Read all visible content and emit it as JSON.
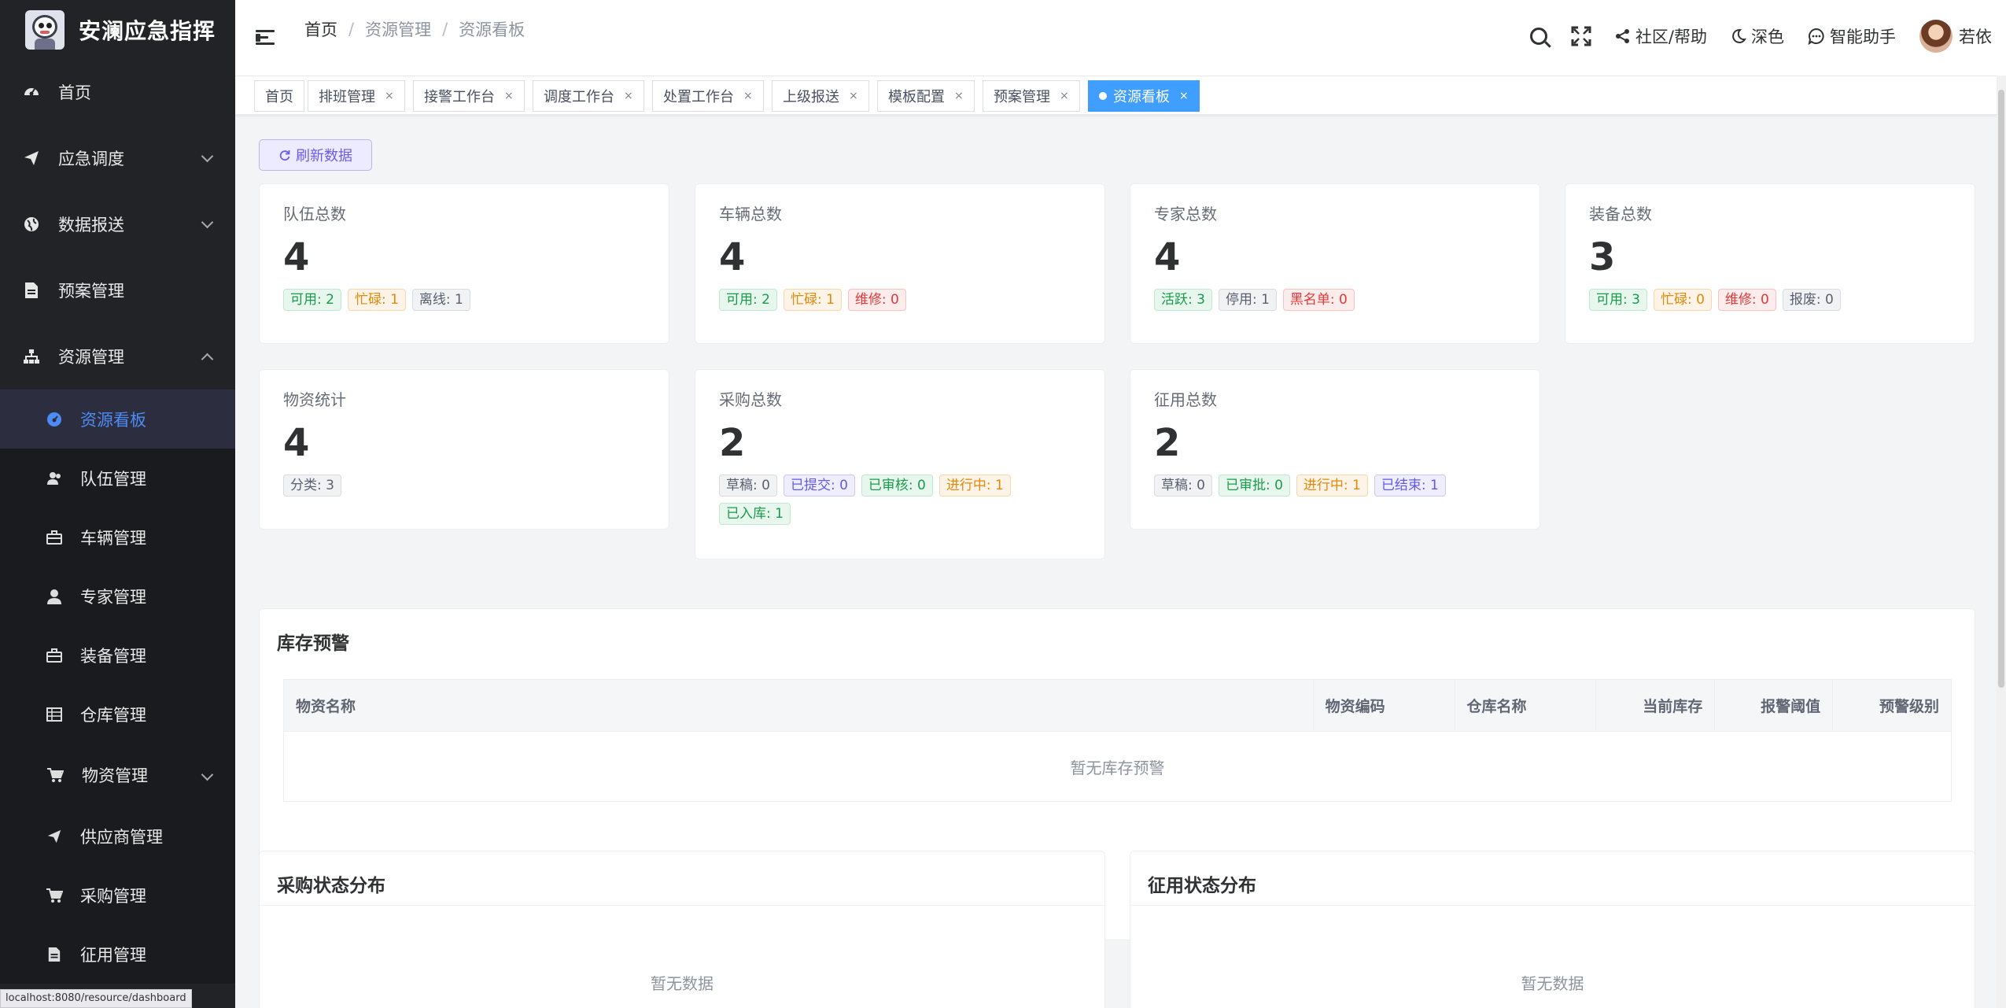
{
  "app": {
    "title": "安澜应急指挥",
    "status_url": "localhost:8080/resource/dashboard"
  },
  "sidebar": {
    "items": [
      {
        "label": "首页",
        "icon": "dashboard-icon"
      },
      {
        "label": "应急调度",
        "icon": "send-icon"
      },
      {
        "label": "数据报送",
        "icon": "globe-icon"
      },
      {
        "label": "预案管理",
        "icon": "document-icon"
      },
      {
        "label": "资源管理",
        "icon": "sitemap-icon"
      }
    ],
    "sub_items": [
      {
        "label": "资源看板",
        "icon": "gauge-icon"
      },
      {
        "label": "队伍管理",
        "icon": "team-icon"
      },
      {
        "label": "车辆管理",
        "icon": "briefcase-icon"
      },
      {
        "label": "专家管理",
        "icon": "user-icon"
      },
      {
        "label": "装备管理",
        "icon": "briefcase-icon"
      },
      {
        "label": "仓库管理",
        "icon": "grid-icon"
      },
      {
        "label": "物资管理",
        "icon": "cart-icon"
      },
      {
        "label": "供应商管理",
        "icon": "send-icon"
      },
      {
        "label": "采购管理",
        "icon": "cart-icon"
      },
      {
        "label": "征用管理",
        "icon": "document-icon"
      }
    ]
  },
  "header": {
    "breadcrumb": [
      "首页",
      "资源管理",
      "资源看板"
    ],
    "community": "社区/帮助",
    "theme": "深色",
    "assistant": "智能助手",
    "user": "若依"
  },
  "tabs": [
    {
      "label": "首页",
      "closable": false
    },
    {
      "label": "排班管理",
      "closable": true
    },
    {
      "label": "接警工作台",
      "closable": true
    },
    {
      "label": "调度工作台",
      "closable": true
    },
    {
      "label": "处置工作台",
      "closable": true
    },
    {
      "label": "上级报送",
      "closable": true
    },
    {
      "label": "模板配置",
      "closable": true
    },
    {
      "label": "预案管理",
      "closable": true
    },
    {
      "label": "资源看板",
      "closable": true,
      "active": true
    }
  ],
  "tab_close": "×",
  "refresh_label": "刷新数据",
  "cards": [
    {
      "title": "队伍总数",
      "value": "4",
      "chips": [
        {
          "text": "可用: 2",
          "color": "green"
        },
        {
          "text": "忙碌: 1",
          "color": "orange"
        },
        {
          "text": "离线: 1",
          "color": "gray"
        }
      ]
    },
    {
      "title": "车辆总数",
      "value": "4",
      "chips": [
        {
          "text": "可用: 2",
          "color": "green"
        },
        {
          "text": "忙碌: 1",
          "color": "orange"
        },
        {
          "text": "维修: 0",
          "color": "red"
        }
      ]
    },
    {
      "title": "专家总数",
      "value": "4",
      "chips": [
        {
          "text": "活跃: 3",
          "color": "green"
        },
        {
          "text": "停用: 1",
          "color": "gray"
        },
        {
          "text": "黑名单: 0",
          "color": "red"
        }
      ]
    },
    {
      "title": "装备总数",
      "value": "3",
      "chips": [
        {
          "text": "可用: 3",
          "color": "green"
        },
        {
          "text": "忙碌: 0",
          "color": "orange"
        },
        {
          "text": "维修: 0",
          "color": "red"
        },
        {
          "text": "报废: 0",
          "color": "gray"
        }
      ]
    },
    {
      "title": "物资统计",
      "value": "4",
      "chips": [
        {
          "text": "分类: 3",
          "color": "gray"
        }
      ]
    },
    {
      "title": "采购总数",
      "value": "2",
      "chips": [
        {
          "text": "草稿: 0",
          "color": "gray"
        },
        {
          "text": "已提交: 0",
          "color": "purple"
        },
        {
          "text": "已审核: 0",
          "color": "green"
        },
        {
          "text": "进行中: 1",
          "color": "orange"
        },
        {
          "text": "已入库: 1",
          "color": "green"
        }
      ]
    },
    {
      "title": "征用总数",
      "value": "2",
      "chips": [
        {
          "text": "草稿: 0",
          "color": "gray"
        },
        {
          "text": "已审批: 0",
          "color": "green"
        },
        {
          "text": "进行中: 1",
          "color": "orange"
        },
        {
          "text": "已结束: 1",
          "color": "purple"
        }
      ]
    }
  ],
  "inventory": {
    "title": "库存预警",
    "columns": [
      "物资名称",
      "物资编码",
      "仓库名称",
      "当前库存",
      "报警阈值",
      "预警级别"
    ],
    "empty": "暂无库存预警"
  },
  "purchase_panel": {
    "title": "采购状态分布",
    "empty": "暂无数据"
  },
  "requisition_panel": {
    "title": "征用状态分布",
    "empty": "暂无数据"
  },
  "colors": {
    "sidebar_bg": "#222327",
    "active_tab": "#409eff",
    "active_menu_text": "#4d8cf5"
  }
}
